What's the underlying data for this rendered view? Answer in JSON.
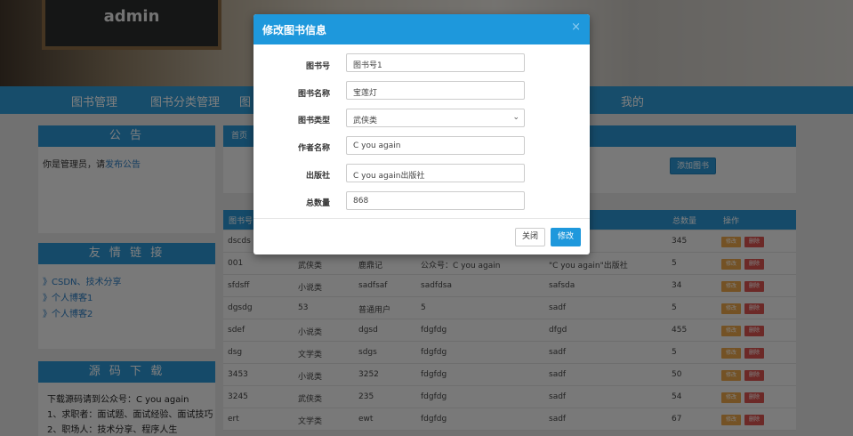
{
  "header": {
    "brand": "admin"
  },
  "nav": {
    "items": [
      "图书管理",
      "图书分类管理",
      "图",
      "我的"
    ]
  },
  "notice": {
    "title": "公 告",
    "text": "你是管理员，请",
    "link": "发布公告"
  },
  "friends": {
    "title": "友 情 链 接",
    "links": [
      "》CSDN、技术分享",
      "》个人博客1",
      "》个人博客2"
    ]
  },
  "source": {
    "title": "源 码 下 载",
    "lines": [
      "下载源码请到公众号：C you again",
      "1、求职者：面试题、面试经验、面试技巧",
      "2、职场人：技术分享、程序人生"
    ]
  },
  "main": {
    "breadcrumb": "首页",
    "add_button": "添加图书"
  },
  "table": {
    "headers": [
      "图书号",
      "总数量",
      "操作"
    ],
    "edit_label": "修改",
    "delete_label": "删除",
    "rows": [
      [
        "dscds",
        "",
        "",
        "",
        "",
        "345"
      ],
      [
        "001",
        "武侠类",
        "鹿鼎记",
        "公众号：C you again",
        "\"C you again\"出版社",
        "5"
      ],
      [
        "sfdsff",
        "小说类",
        "sadfsaf",
        "sadfdsa",
        "safsda",
        "34"
      ],
      [
        "dgsdg",
        "53",
        "普通用户",
        "5",
        "sadf",
        "5"
      ],
      [
        "sdef",
        "小说类",
        "dgsd",
        "fdgfdg",
        "dfgd",
        "455"
      ],
      [
        "dsg",
        "文学类",
        "sdgs",
        "fdgfdg",
        "sadf",
        "5"
      ],
      [
        "3453",
        "小说类",
        "3252",
        "fdgfdg",
        "sadf",
        "50"
      ],
      [
        "3245",
        "武侠类",
        "235",
        "fdgfdg",
        "sadf",
        "54"
      ],
      [
        "ert",
        "文学类",
        "ewt",
        "fdgfdg",
        "sadf",
        "67"
      ]
    ]
  },
  "modal": {
    "title": "修改图书信息",
    "close_icon": "×",
    "fields": [
      {
        "label": "图书号",
        "value": "图书号1"
      },
      {
        "label": "图书名称",
        "value": "宝莲灯"
      },
      {
        "label": "图书类型",
        "value": "武侠类"
      },
      {
        "label": "作者名称",
        "value": "C you again"
      },
      {
        "label": "出版社",
        "value": "C you again出版社"
      },
      {
        "label": "总数量",
        "value": "868"
      }
    ],
    "close_button": "关闭",
    "save_button": "修改"
  },
  "colors": {
    "accent": "#2a94d2",
    "modal_header": "#1e98dc",
    "edit": "#e8a54a",
    "delete": "#d9534f"
  }
}
